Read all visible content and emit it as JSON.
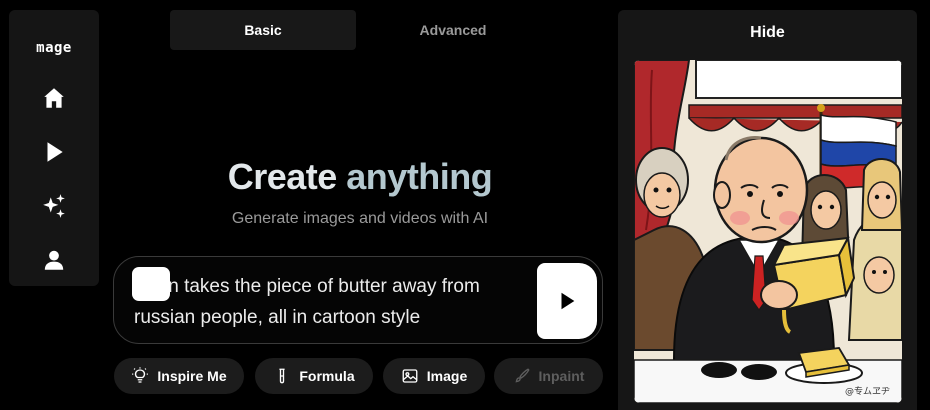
{
  "sidebar": {
    "logo": "mage",
    "items": [
      {
        "name": "home",
        "icon": "home-icon"
      },
      {
        "name": "play",
        "icon": "play-icon"
      },
      {
        "name": "sparkles",
        "icon": "sparkles-icon"
      },
      {
        "name": "profile",
        "icon": "user-icon"
      }
    ]
  },
  "tabs": [
    {
      "label": "Basic",
      "active": true
    },
    {
      "label": "Advanced",
      "active": false
    }
  ],
  "hero": {
    "title_part1": "Create",
    "title_part2": "anything",
    "subtitle": "Generate images and videos with AI"
  },
  "prompt": {
    "text": "in takes the piece of butter away from russian people, all in cartoon style",
    "submit_icon": "play-icon"
  },
  "chips": [
    {
      "label": "Inspire Me",
      "icon": "lightbulb-icon",
      "enabled": true
    },
    {
      "label": "Formula",
      "icon": "test-tube-icon",
      "enabled": true
    },
    {
      "label": "Image",
      "icon": "image-icon",
      "enabled": true
    },
    {
      "label": "Inpaint",
      "icon": "brush-icon",
      "enabled": false
    }
  ],
  "panel": {
    "hide_label": "Hide",
    "image_signature": "@专ムヱヂ"
  },
  "colors": {
    "background": "#000000",
    "surface": "#151515",
    "title_primary": "#e3e8eb",
    "title_accent": "#b4c8cf",
    "muted_text": "#9a9a9a"
  }
}
